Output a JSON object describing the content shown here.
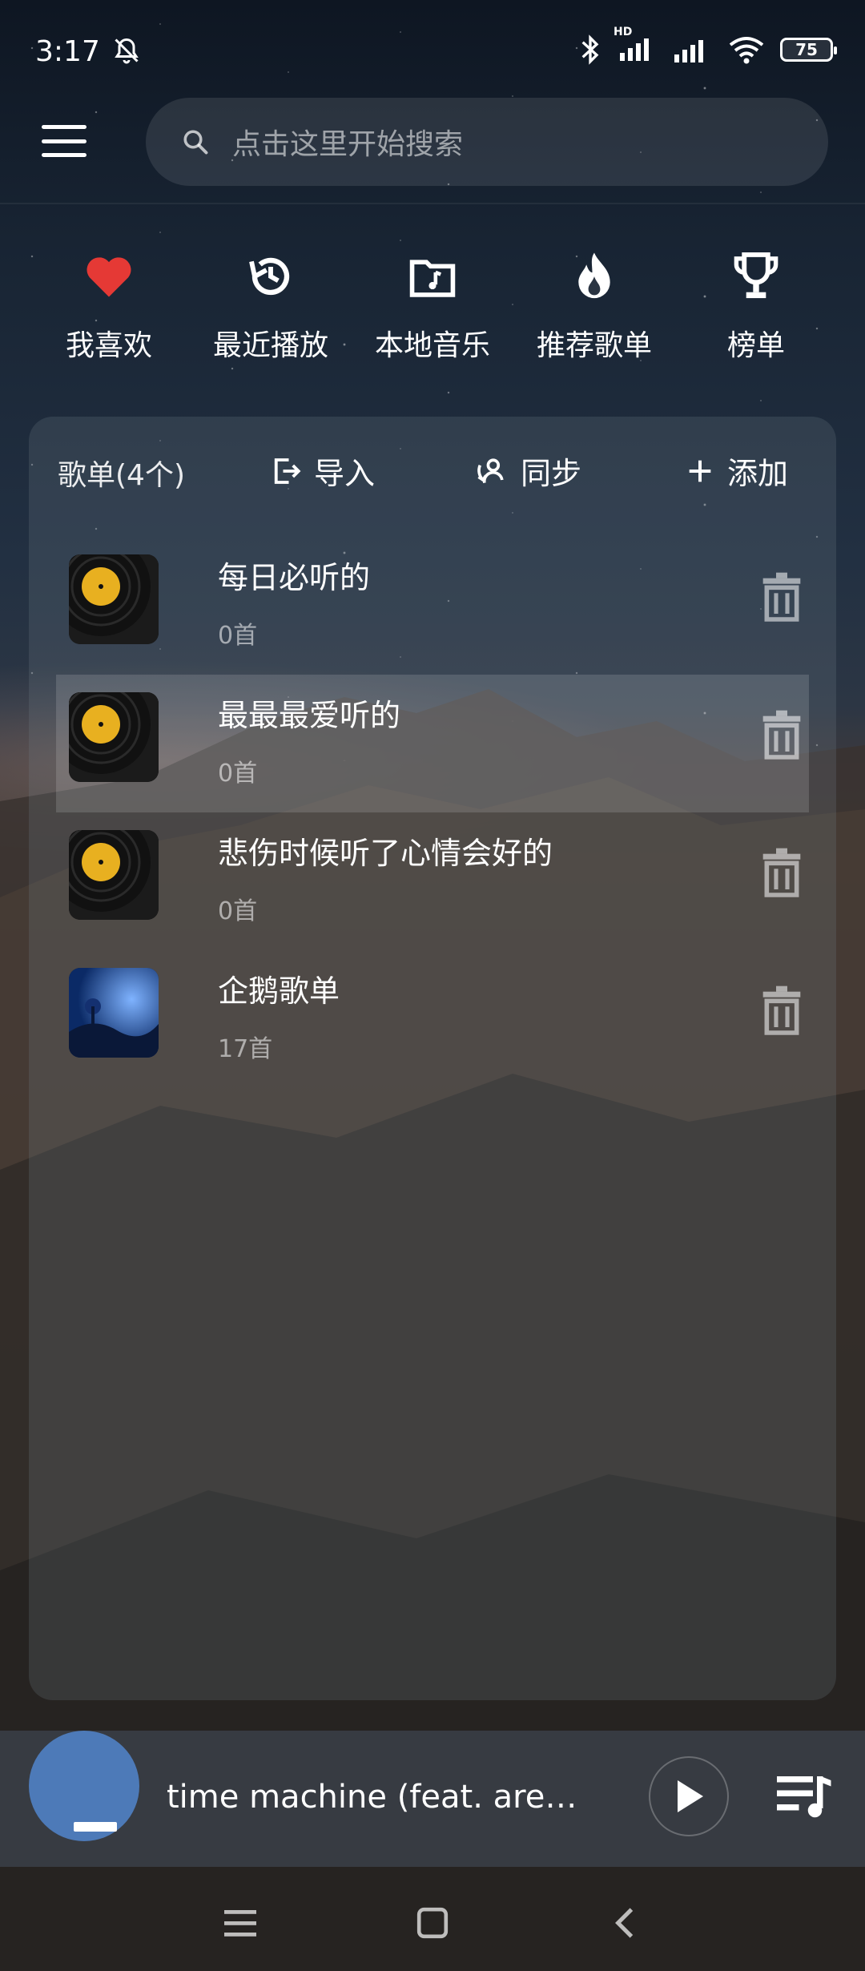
{
  "status_bar": {
    "time": "3:17",
    "battery": "75",
    "hd_label": "HD"
  },
  "search": {
    "placeholder": "点击这里开始搜索"
  },
  "quick_nav": [
    {
      "label": "我喜欢",
      "icon": "heart-icon",
      "color": "#e53935"
    },
    {
      "label": "最近播放",
      "icon": "history-icon"
    },
    {
      "label": "本地音乐",
      "icon": "music-folder-icon"
    },
    {
      "label": "推荐歌单",
      "icon": "fire-icon"
    },
    {
      "label": "榜单",
      "icon": "trophy-icon"
    }
  ],
  "playlist_panel": {
    "title": "歌单(4个)",
    "import_label": "导入",
    "sync_label": "同步",
    "add_label": "添加",
    "items": [
      {
        "name": "每日必听的",
        "count": "0首",
        "cover": "vinyl"
      },
      {
        "name": "最最最爱听的",
        "count": "0首",
        "cover": "vinyl",
        "highlighted": true
      },
      {
        "name": "悲伤时候听了心情会好的",
        "count": "0首",
        "cover": "vinyl"
      },
      {
        "name": "企鹅歌单",
        "count": "17首",
        "cover": "night-scene"
      }
    ]
  },
  "mini_player": {
    "title": "time machine (feat. aren…",
    "cover_color": "#4d7ab8"
  },
  "colors": {
    "accent_heart": "#e53935"
  }
}
